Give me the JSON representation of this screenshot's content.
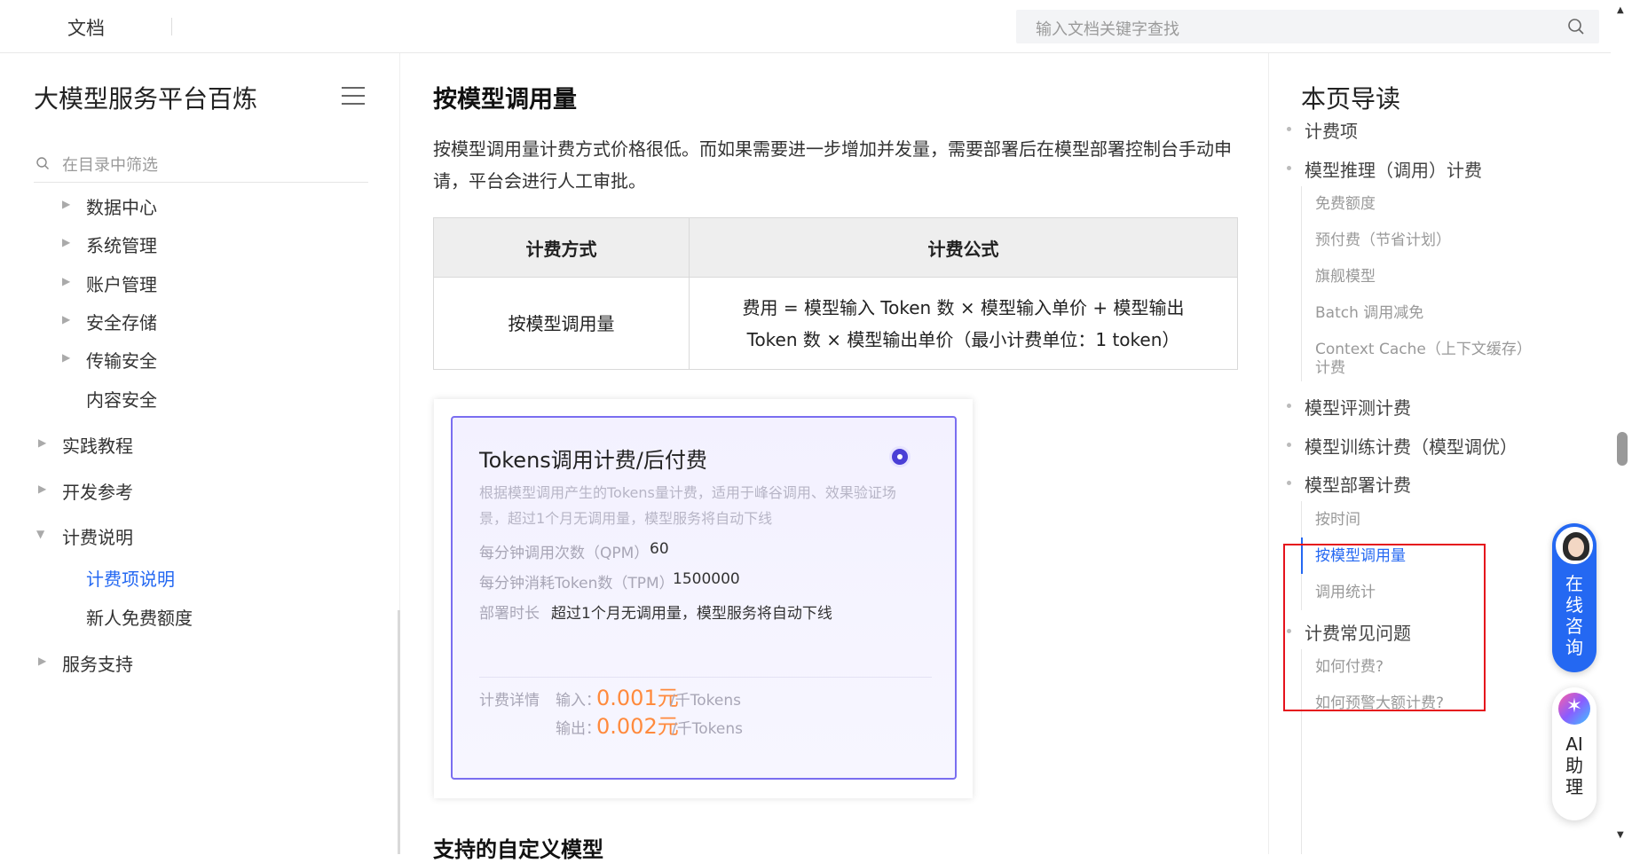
{
  "topbar": {
    "doc_label": "文档",
    "search_placeholder": "输入文档关键字查找"
  },
  "sidebar": {
    "title": "大模型服务平台百炼",
    "filter_placeholder": "在目录中筛选",
    "items": [
      {
        "label": "数据中心",
        "arrow": "▶"
      },
      {
        "label": "系统管理",
        "arrow": "▶"
      },
      {
        "label": "账户管理",
        "arrow": "▶"
      },
      {
        "label": "安全存储",
        "arrow": "▶"
      },
      {
        "label": "传输安全",
        "arrow": "▶"
      },
      {
        "label": "内容安全"
      },
      {
        "label": "实践教程",
        "arrow": "▶"
      },
      {
        "label": "开发参考",
        "arrow": "▶"
      },
      {
        "label": "计费说明",
        "arrow": "▼"
      },
      {
        "label": "计费项说明"
      },
      {
        "label": "新人免费额度"
      },
      {
        "label": "服务支持",
        "arrow": "▶"
      }
    ]
  },
  "main": {
    "heading": "按模型调用量",
    "paragraph": "按模型调用量计费方式价格很低。而如果需要进一步增加并发量，需要部署后在模型部署控制台手动申请，平台会进行人工审批。",
    "table": {
      "headers": [
        "计费方式",
        "计费公式"
      ],
      "row": [
        "按模型调用量",
        "费用 = 模型输入 Token 数 × 模型输入单价 + 模型输出 Token 数 × 模型输出单价（最小计费单位：1 token）"
      ]
    },
    "card": {
      "title": "Tokens调用计费/后付费",
      "description": "根据模型调用产生的Tokens量计费，适用于峰谷调用、效果验证场景，超过1个月无调用量，模型服务将自动下线",
      "qpm_label": "每分钟调用次数（QPM）",
      "qpm_value": "60",
      "tpm_label": "每分钟消耗Token数（TPM）",
      "tpm_value": "1500000",
      "duration_label": "部署时长",
      "duration_value": "超过1个月无调用量，模型服务将自动下线",
      "fee_label": "计费详情",
      "input_label": "输入：",
      "input_price": "0.001元",
      "input_unit": "/千Tokens",
      "output_label": "输出：",
      "output_price": "0.002元",
      "output_unit": "/千Tokens"
    },
    "next_heading": "支持的自定义模型"
  },
  "toc": {
    "title": "本页导读",
    "items": [
      {
        "label": "计费项"
      },
      {
        "label": "模型推理（调用）计费"
      },
      {
        "label": "免费额度"
      },
      {
        "label": "预付费（节省计划）"
      },
      {
        "label": "旗舰模型"
      },
      {
        "label": "Batch 调用减免"
      },
      {
        "label": "Context Cache（上下文缓存）"
      },
      {
        "label": "计费"
      },
      {
        "label": "模型评测计费"
      },
      {
        "label": "模型训练计费（模型调优）"
      },
      {
        "label": "模型部署计费"
      },
      {
        "label": "按时间"
      },
      {
        "label": "按模型调用量"
      },
      {
        "label": "调用统计"
      },
      {
        "label": "计费常见问题"
      },
      {
        "label": "如何付费?"
      },
      {
        "label": "如何预警大额计费?"
      }
    ]
  },
  "floating": {
    "consult": [
      "在",
      "线",
      "咨",
      "询"
    ],
    "ai": [
      "AI",
      "助",
      "理"
    ]
  },
  "colors": {
    "accent": "#2468f2",
    "highlight_box": "#e5121c",
    "price": "#ff8a3d",
    "card_border": "#7a6ef0"
  }
}
